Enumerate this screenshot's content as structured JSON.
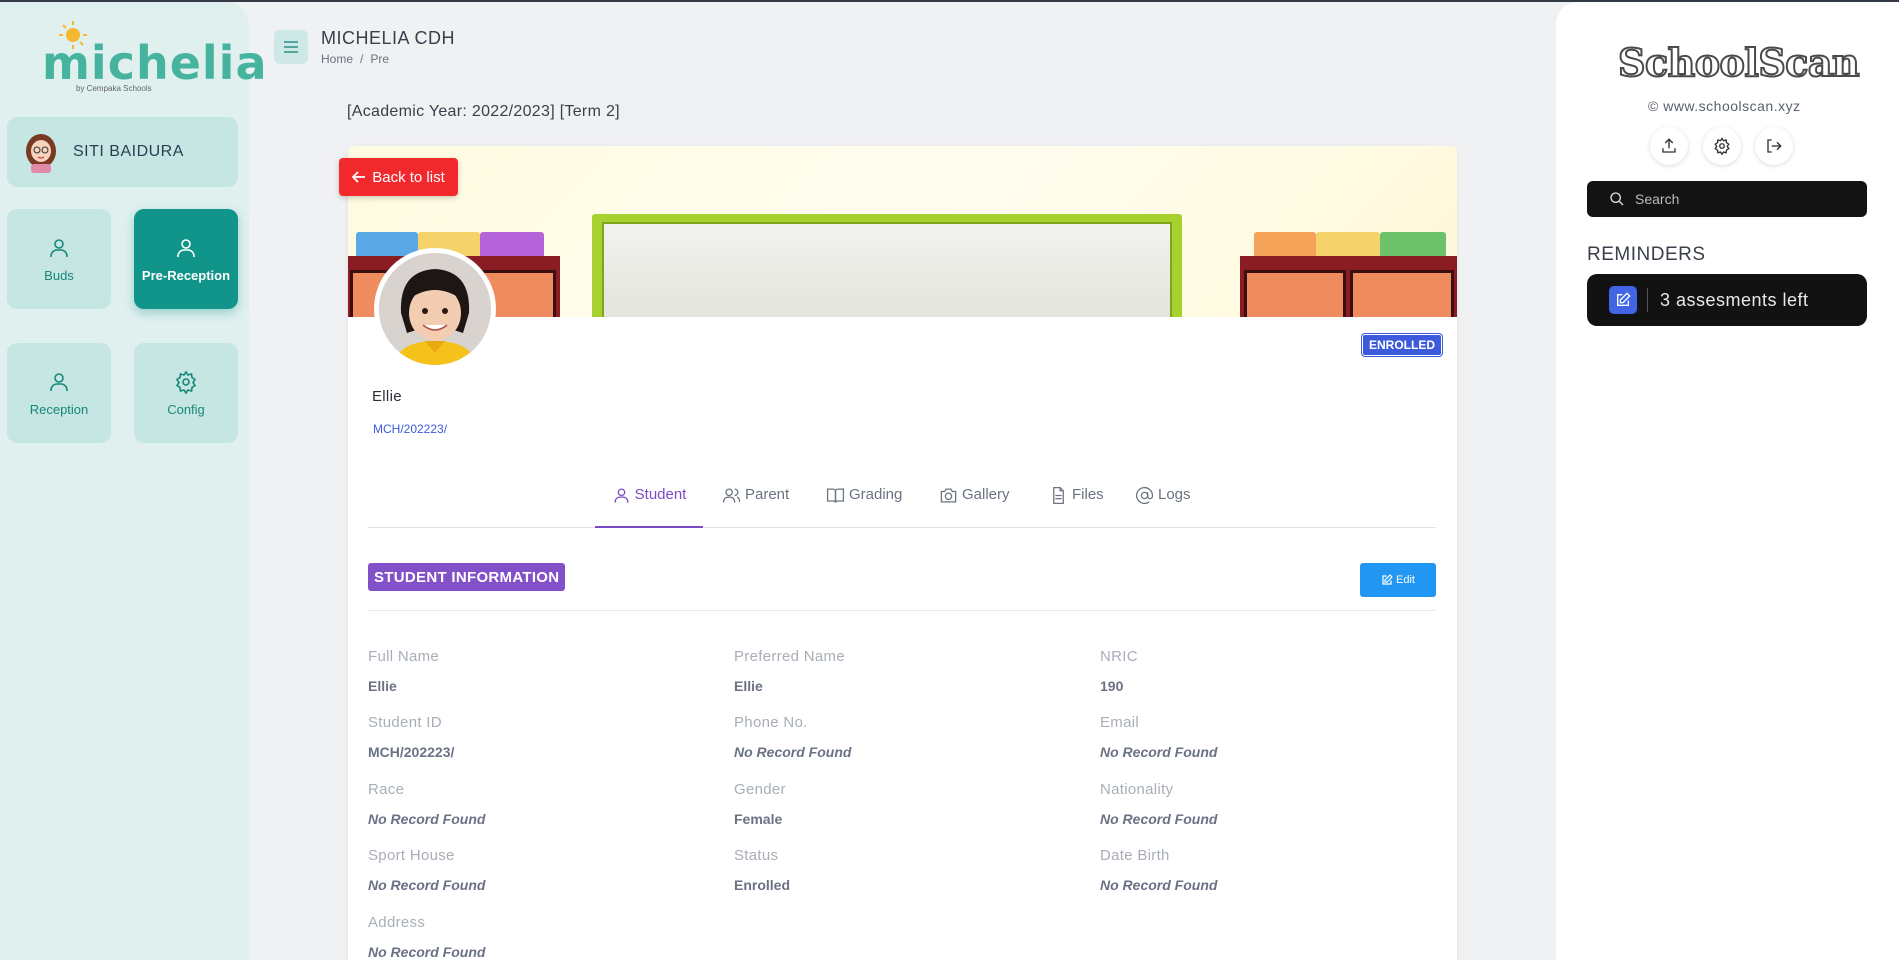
{
  "sidebar": {
    "logo": {
      "text": "michelia",
      "subtext": "by Cempaka Schools"
    },
    "user": {
      "name": "SITI BAIDURA"
    },
    "nav": [
      {
        "label": "Buds",
        "icon": "user-icon",
        "active": false
      },
      {
        "label": "Pre-Reception",
        "icon": "user-icon",
        "active": true
      },
      {
        "label": "Reception",
        "icon": "user-icon",
        "active": false
      },
      {
        "label": "Config",
        "icon": "gear-icon",
        "active": false
      }
    ]
  },
  "header": {
    "title": "MICHELIA CDH",
    "breadcrumb": [
      "Home",
      "Pre"
    ]
  },
  "main": {
    "academic_year": "[Academic Year: 2022/2023] [Term 2]",
    "back_label": "Back to list",
    "status_badge": "ENROLLED",
    "student_name": "Ellie",
    "student_id": "MCH/202223/",
    "tabs": [
      {
        "label": "Student",
        "icon": "user-icon",
        "active": true
      },
      {
        "label": "Parent",
        "icon": "users-icon",
        "active": false
      },
      {
        "label": "Grading",
        "icon": "book-icon",
        "active": false
      },
      {
        "label": "Gallery",
        "icon": "camera-icon",
        "active": false
      },
      {
        "label": "Files",
        "icon": "file-icon",
        "active": false
      },
      {
        "label": "Logs",
        "icon": "at-icon",
        "active": false
      }
    ],
    "section_title": "STUDENT INFORMATION",
    "edit_label": "Edit",
    "fields": [
      {
        "label": "Full Name",
        "value": "Ellie",
        "empty": false
      },
      {
        "label": "Preferred Name",
        "value": "Ellie",
        "empty": false
      },
      {
        "label": "NRIC",
        "value": "190",
        "empty": false
      },
      {
        "label": "Student ID",
        "value": "MCH/202223/",
        "empty": false
      },
      {
        "label": "Phone No.",
        "value": "No Record Found",
        "empty": true
      },
      {
        "label": "Email",
        "value": "No Record Found",
        "empty": true
      },
      {
        "label": "Race",
        "value": "No Record Found",
        "empty": true
      },
      {
        "label": "Gender",
        "value": "Female",
        "empty": false
      },
      {
        "label": "Nationality",
        "value": "No Record Found",
        "empty": true
      },
      {
        "label": "Sport House",
        "value": "No Record Found",
        "empty": true
      },
      {
        "label": "Status",
        "value": "Enrolled",
        "empty": false
      },
      {
        "label": "Date Birth",
        "value": "No Record Found",
        "empty": true
      },
      {
        "label": "Address",
        "value": "No Record Found",
        "empty": true
      }
    ]
  },
  "right": {
    "brand": "SchoolScan",
    "url": "© www.schoolscan.xyz",
    "actions": [
      {
        "name": "upload-icon"
      },
      {
        "name": "settings-icon"
      },
      {
        "name": "logout-icon"
      }
    ],
    "search_placeholder": "Search",
    "reminders_title": "REMINDERS",
    "reminder_text": "3 assesments left"
  },
  "colors": {
    "accent_teal": "#119489",
    "back_red": "#f1292d",
    "section_purple": "#8250c8",
    "edit_blue": "#2196f3",
    "badge_blue": "#3b5bdb"
  }
}
